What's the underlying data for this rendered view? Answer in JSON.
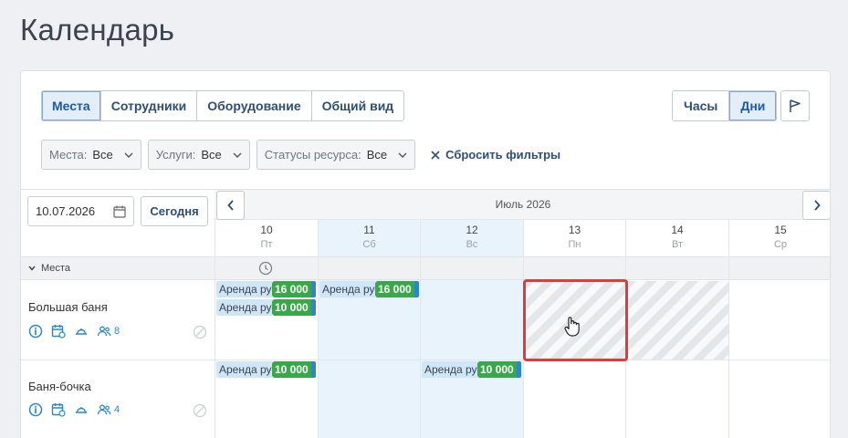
{
  "page": {
    "title": "Календарь"
  },
  "tabs": [
    {
      "label": "Места",
      "active": true
    },
    {
      "label": "Сотрудники",
      "active": false
    },
    {
      "label": "Оборудование",
      "active": false
    },
    {
      "label": "Общий вид",
      "active": false
    }
  ],
  "view_mode": {
    "hours": "Часы",
    "days": "Дни",
    "active": "days"
  },
  "filters": {
    "places": {
      "label": "Места:",
      "value": "Все"
    },
    "services": {
      "label": "Услуги:",
      "value": "Все"
    },
    "statuses": {
      "label": "Статусы ресурса:",
      "value": "Все"
    },
    "reset_label": "Сбросить фильтры"
  },
  "date_picker": {
    "value": "10.07.2026",
    "today_label": "Сегодня"
  },
  "calendar": {
    "month": "Июль 2026",
    "days": [
      {
        "num": "10",
        "dow": "Пт",
        "weekend": false
      },
      {
        "num": "11",
        "dow": "Сб",
        "weekend": true
      },
      {
        "num": "12",
        "dow": "Вс",
        "weekend": true
      },
      {
        "num": "13",
        "dow": "Пн",
        "weekend": false
      },
      {
        "num": "14",
        "dow": "Вт",
        "weekend": false
      },
      {
        "num": "15",
        "dow": "Ср",
        "weekend": false
      }
    ],
    "group_label": "Места"
  },
  "resources": [
    {
      "name": "Большая баня",
      "capacity": "8",
      "events": [
        {
          "day": "10",
          "title": "Аренда русской",
          "price": "16 000"
        },
        {
          "day": "10",
          "title": "Аренда русской",
          "price": "10 000"
        },
        {
          "day": "11",
          "title": "Аренда русской",
          "price": "16 000"
        }
      ]
    },
    {
      "name": "Баня-бочка",
      "capacity": "4",
      "events": [
        {
          "day": "10",
          "title": "Аренда русской",
          "price": "10 000"
        },
        {
          "day": "12",
          "title": "Аренда русской",
          "price": "10 000"
        }
      ]
    }
  ],
  "colors": {
    "accent": "#1d5aa6",
    "price": "#3aa84a",
    "weekend": "#e8f3fc",
    "selection": "#e03b3b",
    "icon": "#2a87cc"
  }
}
